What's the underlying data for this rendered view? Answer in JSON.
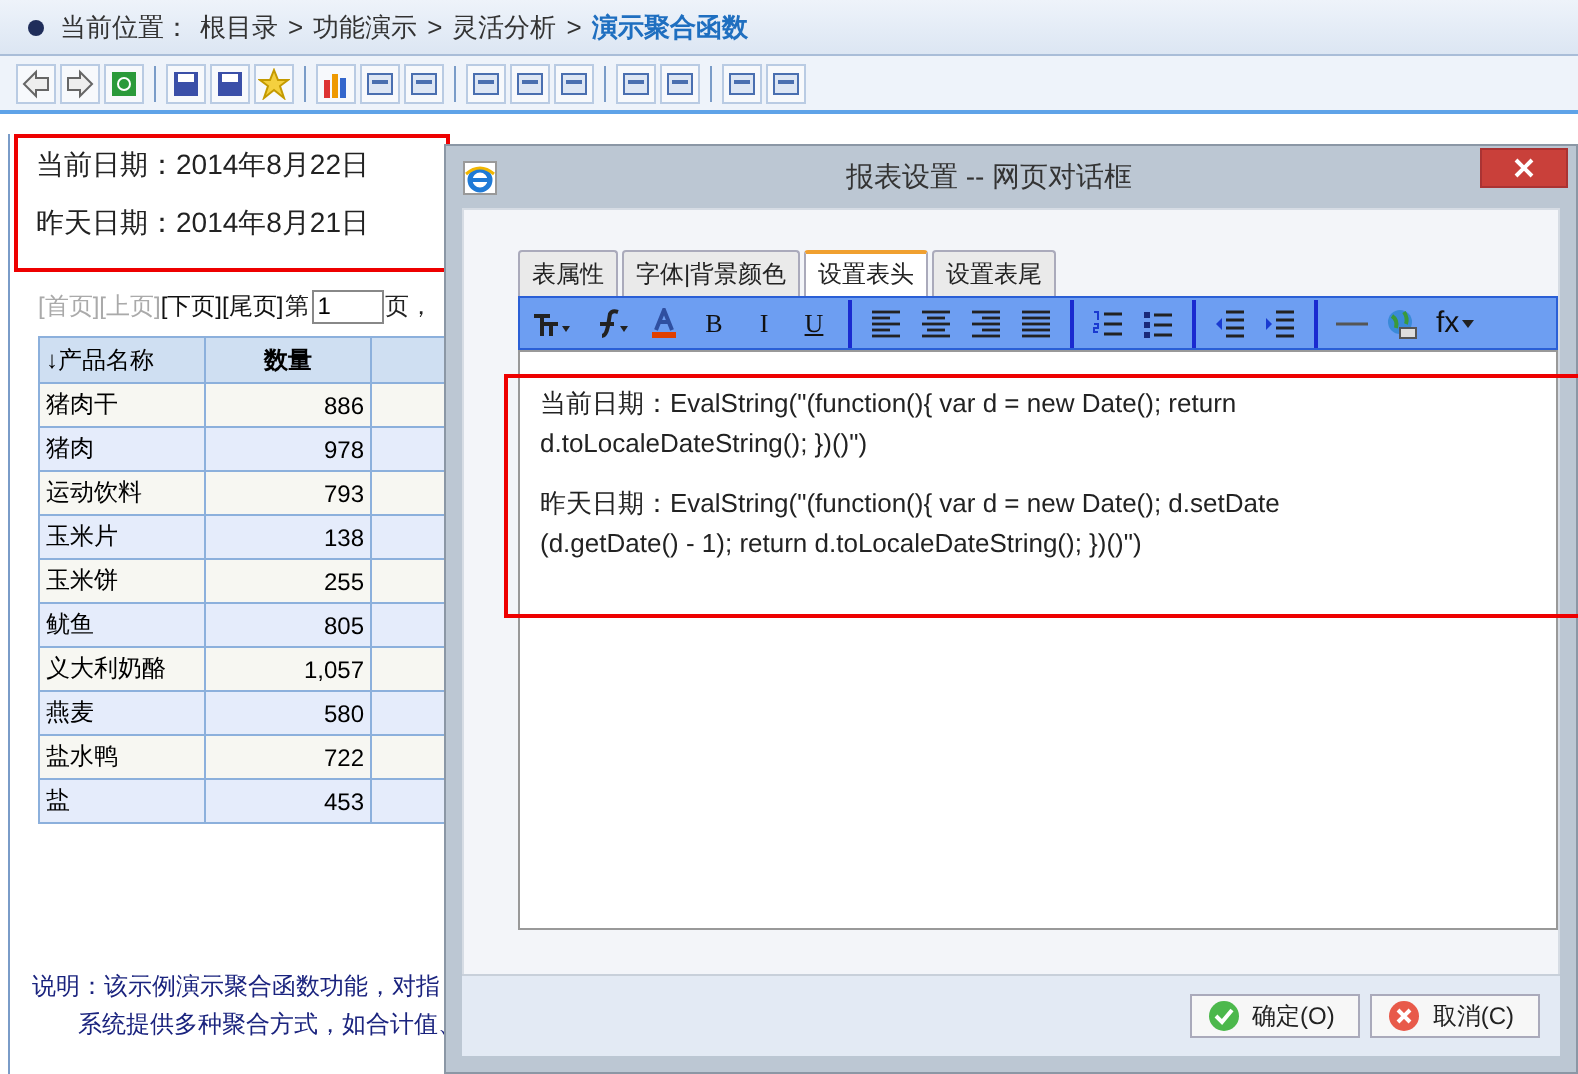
{
  "breadcrumb": {
    "label": "当前位置：",
    "path": [
      "根目录",
      "功能演示",
      "灵活分析"
    ],
    "separator": ">",
    "current": "演示聚合函数"
  },
  "report_header": {
    "lines": [
      "当前日期：2014年8月22日",
      "昨天日期：2014年8月21日"
    ]
  },
  "pager": {
    "links": [
      {
        "label": "[首页]",
        "disabled": true
      },
      {
        "label": "[上页]",
        "disabled": true
      },
      {
        "label": "[下页]",
        "disabled": false
      },
      {
        "label": "[尾页]",
        "disabled": false
      }
    ],
    "before": "第",
    "page": "1",
    "after": "页，"
  },
  "table": {
    "columns": [
      "↓产品名称",
      "数量"
    ],
    "rows": [
      [
        "猪肉干",
        "886"
      ],
      [
        "猪肉",
        "978"
      ],
      [
        "运动饮料",
        "793"
      ],
      [
        "玉米片",
        "138"
      ],
      [
        "玉米饼",
        "255"
      ],
      [
        "鱿鱼",
        "805"
      ],
      [
        "义大利奶酪",
        "1,057"
      ],
      [
        "燕麦",
        "580"
      ],
      [
        "盐水鸭",
        "722"
      ],
      [
        "盐",
        "453"
      ]
    ]
  },
  "note": [
    "说明：该示例演示聚合函数功能，对指",
    "系统提供多种聚合方式，如合计值、"
  ],
  "dialog": {
    "title": "报表设置 -- 网页对话框",
    "tabs": [
      {
        "label": "表属性",
        "selected": false
      },
      {
        "label": "字体|背景颜色",
        "selected": false
      },
      {
        "label": "设置表头",
        "selected": true
      },
      {
        "label": "设置表尾",
        "selected": false
      }
    ],
    "format_buttons": [
      "B",
      "I",
      "U"
    ],
    "function_button": "fx",
    "editor_lines": [
      "当前日期：EvalString(\"(function(){ var d = new Date(); return d.toLocaleDateString(); })()\")",
      "昨天日期：EvalString(\"(function(){ var d = new Date(); d.setDate (d.getDate() - 1); return d.toLocaleDateString(); })()\")"
    ],
    "buttons": [
      {
        "label": "确定(O)",
        "kind": "ok"
      },
      {
        "label": "取消(C)",
        "kind": "cancel"
      }
    ]
  }
}
